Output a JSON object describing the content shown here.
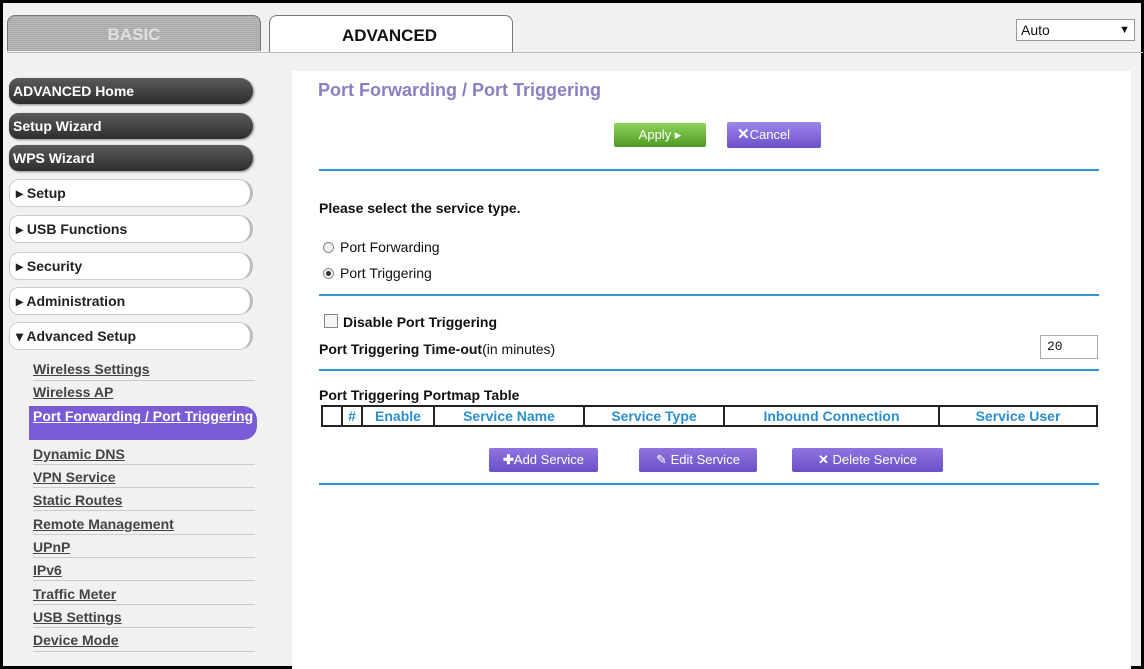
{
  "tabs": {
    "basic": "BASIC",
    "advanced": "ADVANCED"
  },
  "language_select": {
    "value": "Auto"
  },
  "sidebar": {
    "main_items": [
      "ADVANCED Home",
      "Setup Wizard",
      "WPS Wizard"
    ],
    "sections": [
      "▸ Setup",
      "▸ USB Functions",
      "▸ Security",
      "▸ Administration",
      "▾ Advanced Setup"
    ],
    "sub_items": [
      "Wireless Settings",
      "Wireless AP",
      "Port Forwarding / Port Triggering",
      "Dynamic DNS",
      "VPN Service",
      "Static Routes",
      "Remote Management",
      "UPnP",
      "IPv6",
      "Traffic Meter",
      "USB Settings",
      "Device Mode"
    ]
  },
  "main": {
    "title": "Port Forwarding / Port Triggering",
    "apply_label": "Apply ▸",
    "cancel_label": "Cancel",
    "service_type_prompt": "Please select the service type.",
    "radio_forwarding": "Port Forwarding",
    "radio_triggering": "Port Triggering",
    "selected_radio": "Port Triggering",
    "disable_label": "Disable Port Triggering",
    "timeout_label_bold": "Port Triggering Time-out",
    "timeout_label_suffix": "(in minutes)",
    "timeout_value": "20",
    "table_title": "Port Triggering Portmap Table",
    "table_headers": [
      "",
      "#",
      "Enable",
      "Service Name",
      "Service Type",
      "Inbound Connection",
      "Service User"
    ],
    "add_service": "Add Service",
    "edit_service": "Edit Service",
    "delete_service": "Delete Service"
  },
  "colors": {
    "accent_blue": "#2a9ad6",
    "title_purple": "#8b7ec2",
    "button_purple": "#6b50c8",
    "apply_green": "#5aa82a"
  }
}
